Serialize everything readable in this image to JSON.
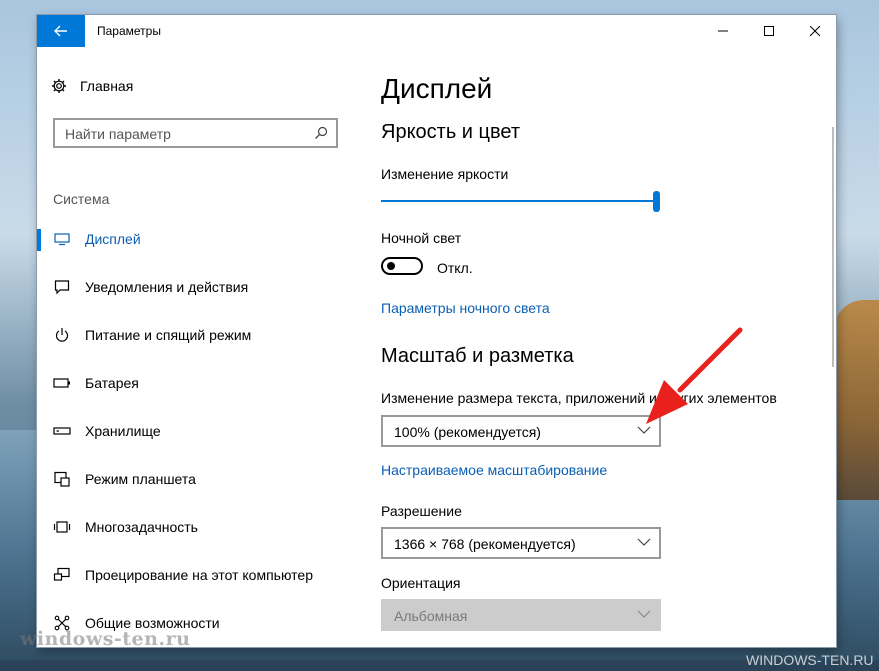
{
  "window": {
    "title": "Параметры"
  },
  "sidebar": {
    "home_label": "Главная",
    "search_placeholder": "Найти параметр",
    "section_label": "Система",
    "items": [
      {
        "label": "Дисплей",
        "icon": "monitor-icon",
        "active": true
      },
      {
        "label": "Уведомления и действия",
        "icon": "notification-icon",
        "active": false
      },
      {
        "label": "Питание и спящий режим",
        "icon": "power-icon",
        "active": false
      },
      {
        "label": "Батарея",
        "icon": "battery-icon",
        "active": false
      },
      {
        "label": "Хранилище",
        "icon": "storage-icon",
        "active": false
      },
      {
        "label": "Режим планшета",
        "icon": "tablet-icon",
        "active": false
      },
      {
        "label": "Многозадачность",
        "icon": "multitask-icon",
        "active": false
      },
      {
        "label": "Проецирование на этот компьютер",
        "icon": "projection-icon",
        "active": false
      },
      {
        "label": "Общие возможности",
        "icon": "shared-icon",
        "active": false
      }
    ]
  },
  "main": {
    "page_title": "Дисплей",
    "brightness_heading": "Яркость и цвет",
    "brightness_label": "Изменение яркости",
    "brightness_value": 1.0,
    "night_light_label": "Ночной свет",
    "night_light_state": "Откл.",
    "night_light_link": "Параметры ночного света",
    "scale_heading": "Масштаб и разметка",
    "scale_label": "Изменение размера текста, приложений и других элементов",
    "scale_value": "100% (рекомендуется)",
    "custom_scale_link": "Настраиваемое масштабирование",
    "resolution_label": "Разрешение",
    "resolution_value": "1366 × 768 (рекомендуется)",
    "orientation_label": "Ориентация",
    "orientation_value": "Альбомная"
  },
  "watermarks": {
    "left": "windows-ten.ru",
    "right": "WINDOWS-TEN.RU"
  },
  "colors": {
    "accent": "#0078d7",
    "link": "#0a5fb4",
    "arrow": "#e8211c"
  }
}
